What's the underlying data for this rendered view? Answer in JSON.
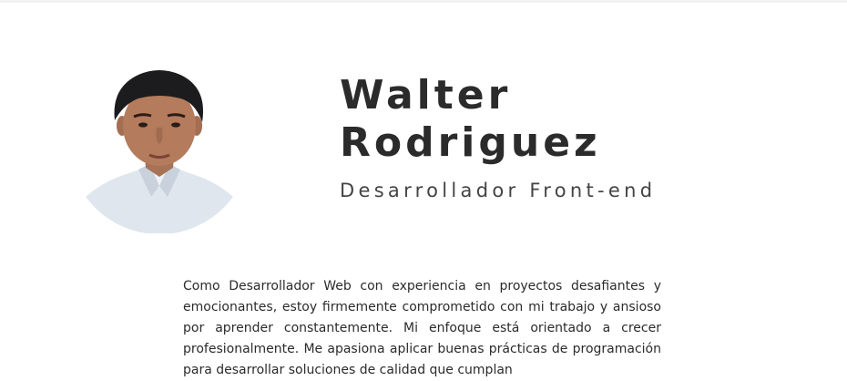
{
  "profile": {
    "first_name": "Walter",
    "last_name": "Rodriguez",
    "role": "Desarrollador Front-end",
    "bio": "Como Desarrollador Web con experiencia en proyectos desafiantes y emocionantes, estoy firmemente comprometido con mi trabajo y ansioso por aprender constantemente. Mi enfoque está orientado a crecer profesionalmente. Me apasiona aplicar buenas prácticas de programación para desarrollar soluciones de calidad que cumplan"
  },
  "colors": {
    "text": "#2b2b2b",
    "background": "#ffffff"
  },
  "icons": {
    "avatar": "profile-photo"
  }
}
